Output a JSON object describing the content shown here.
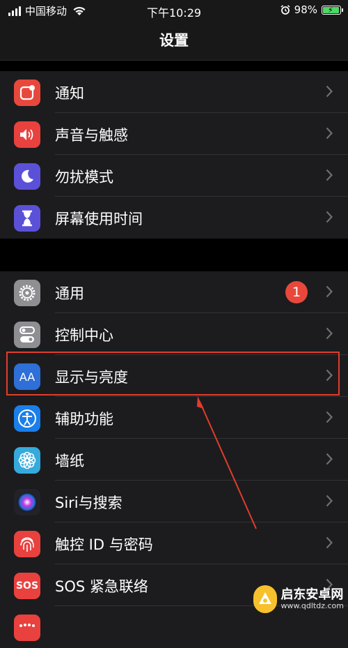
{
  "status_bar": {
    "carrier": "中国移动",
    "time": "下午10:29",
    "battery": "98%"
  },
  "nav": {
    "title": "设置"
  },
  "groups": [
    {
      "items": [
        {
          "label": "通知",
          "icon": "notifications-icon",
          "color": "#e8483c"
        },
        {
          "label": "声音与触感",
          "icon": "speaker-icon",
          "color": "#e8413e"
        },
        {
          "label": "勿扰模式",
          "icon": "moon-icon",
          "color": "#5b51d8"
        },
        {
          "label": "屏幕使用时间",
          "icon": "hourglass-icon",
          "color": "#5b51d8"
        }
      ]
    },
    {
      "items": [
        {
          "label": "通用",
          "icon": "gear-icon",
          "color": "#8e8e93",
          "badge": "1"
        },
        {
          "label": "控制中心",
          "icon": "toggles-icon",
          "color": "#8e8e93"
        },
        {
          "label": "显示与亮度",
          "icon": "text-size-icon",
          "color": "#2e6fd8",
          "icon_text": "AA"
        },
        {
          "label": "辅助功能",
          "icon": "accessibility-icon",
          "color": "#1a7fea"
        },
        {
          "label": "墙纸",
          "icon": "flower-icon",
          "color": "#35aadc"
        },
        {
          "label": "Siri与搜索",
          "icon": "siri-icon",
          "color": "#222228"
        },
        {
          "label": "触控 ID 与密码",
          "icon": "fingerprint-icon",
          "color": "#e8413e"
        },
        {
          "label": "SOS 紧急联络",
          "icon": "sos-icon",
          "color": "#e8413e",
          "icon_text": "SOS"
        },
        {
          "label": "",
          "icon": "privacy-icon",
          "color": "#e8413e"
        }
      ]
    }
  ],
  "watermark": {
    "main": "启东安卓网",
    "url": "www.qdltdz.com"
  },
  "colors": {
    "background": "#000000",
    "cell": "#1c1c1e",
    "highlight": "#e23c2c"
  }
}
